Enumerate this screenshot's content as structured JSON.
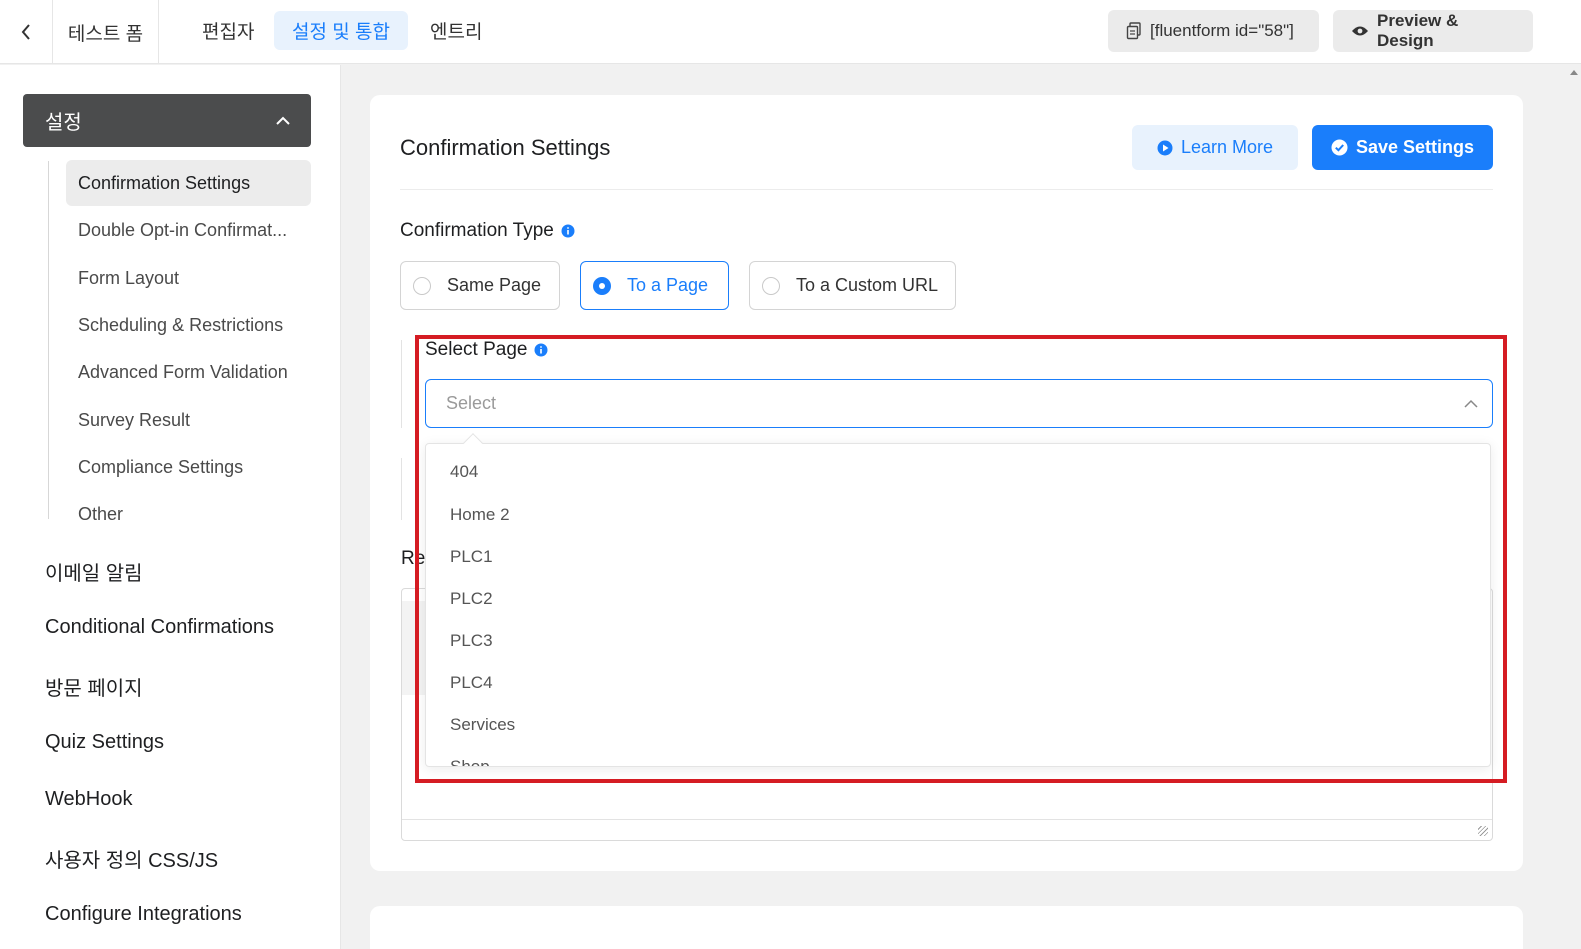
{
  "topbar": {
    "form_title": "테스트 폼",
    "tabs": [
      {
        "label": "편집자",
        "active": false
      },
      {
        "label": "설정 및 통합",
        "active": true
      },
      {
        "label": "엔트리",
        "active": false
      }
    ],
    "shortcode": "[fluentform id=\"58\"]",
    "preview_label": "Preview & Design"
  },
  "sidebar": {
    "header": "설정",
    "sub_items": [
      {
        "label": "Confirmation Settings",
        "active": true
      },
      {
        "label": "Double Opt-in Confirmat...",
        "active": false
      },
      {
        "label": "Form Layout",
        "active": false
      },
      {
        "label": "Scheduling & Restrictions",
        "active": false
      },
      {
        "label": "Advanced Form Validation",
        "active": false
      },
      {
        "label": "Survey Result",
        "active": false
      },
      {
        "label": "Compliance Settings",
        "active": false
      },
      {
        "label": "Other",
        "active": false
      }
    ],
    "main_items": [
      "이메일 알림",
      "Conditional Confirmations",
      "방문 페이지",
      "Quiz Settings",
      "WebHook",
      "사용자 정의 CSS/JS",
      "Configure Integrations"
    ]
  },
  "main": {
    "title": "Confirmation Settings",
    "learn_more": "Learn More",
    "save_settings": "Save Settings",
    "confirmation_type_label": "Confirmation Type",
    "confirmation_options": [
      {
        "label": "Same Page",
        "checked": false
      },
      {
        "label": "To a Page",
        "checked": true
      },
      {
        "label": "To a Custom URL",
        "checked": false
      }
    ],
    "select_page_label": "Select Page",
    "select_placeholder": "Select",
    "page_options": [
      "404",
      "Home 2",
      "PLC1",
      "PLC2",
      "PLC3",
      "PLC4",
      "Services",
      "Shop"
    ],
    "partial_label": "Re"
  },
  "colors": {
    "accent": "#1a7efb",
    "highlight": "#d51c23",
    "sidebar_header_bg": "#4b4c4d"
  }
}
